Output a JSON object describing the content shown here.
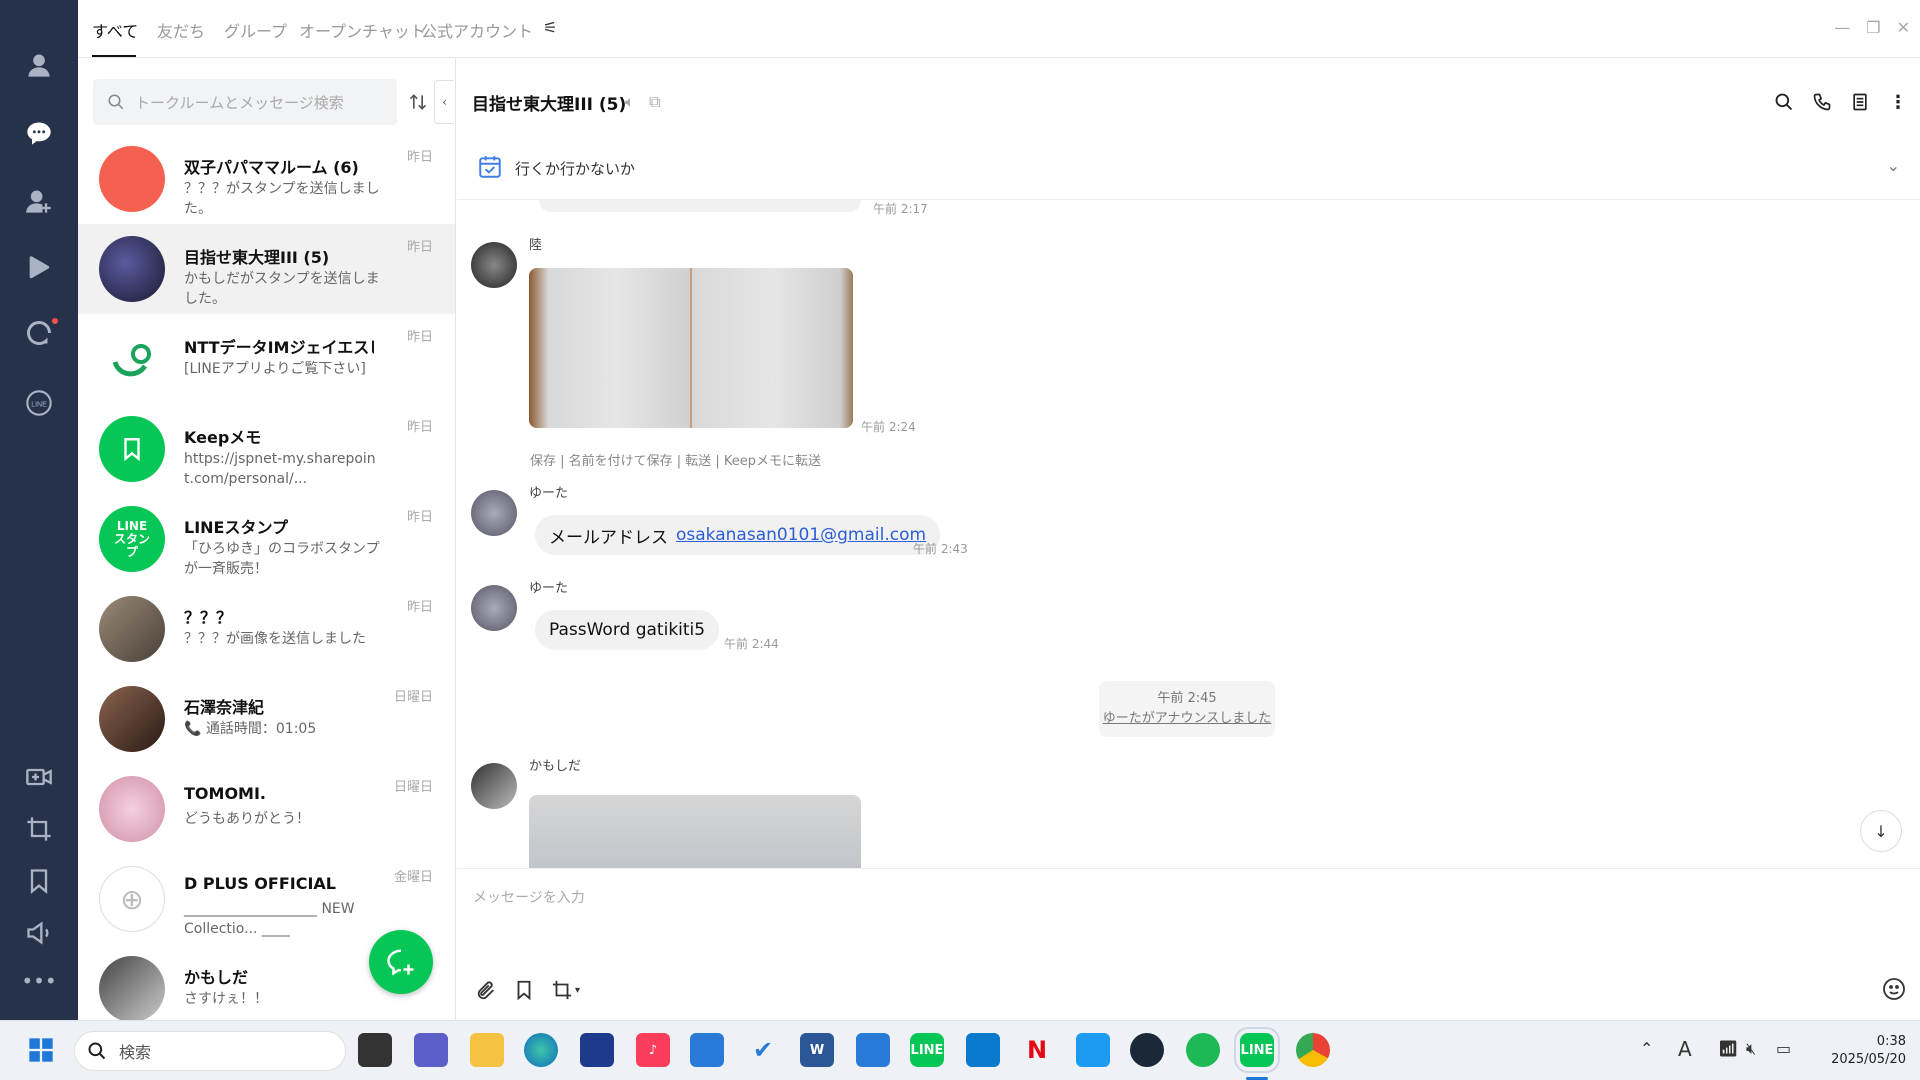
{
  "tabs": [
    "すべて",
    "友だち",
    "グループ",
    "オープンチャット",
    "公式アカウント"
  ],
  "search": {
    "placeholder": "トークルームとメッセージ検索"
  },
  "rooms": [
    {
      "name": "双子パパママルーム (6)",
      "msg": "？？？がスタンプを送信しました。",
      "time": "昨日",
      "color": "#f46150"
    },
    {
      "name": "目指せ東大理III (5)",
      "msg": "かもしだがスタンプを送信しました。",
      "time": "昨日",
      "color": "#3a3a6a"
    },
    {
      "name": "NTTデータIMジェイエスピー...",
      "msg": "[LINEアプリよりご覧下さい]",
      "time": "昨日",
      "color": "#ffffff"
    },
    {
      "name": "Keepメモ",
      "msg": "https://jspnet-my.sharepoint.com/personal/...",
      "time": "昨日",
      "color": "#06c755"
    },
    {
      "name": "LINEスタンプ",
      "msg": "「ひろゆき」のコラボスタンプが一斉販売！",
      "time": "昨日",
      "color": "#06c755"
    },
    {
      "name": "？？？",
      "msg": "？？？が画像を送信しました",
      "time": "昨日",
      "color": "#8a7a6a"
    },
    {
      "name": "石澤奈津紀",
      "msg": "📞 通話時間：01:05",
      "time": "日曜日",
      "color": "#6a5040"
    },
    {
      "name": "TOMOMI.",
      "msg": "どうもありがとう！",
      "time": "日曜日",
      "color": "#e8c0d0"
    },
    {
      "name": "D PLUS OFFICIAL",
      "msg": "___________________ NEW Collectio... ____",
      "time": "金曜日",
      "color": "#ffffff"
    },
    {
      "name": "かもしだ",
      "msg": "さすけぇ！！",
      "time": "",
      "color": "#555555"
    }
  ],
  "line_sticker_badge": "LINE スタンプ",
  "chat": {
    "title": "目指せ東大理III (5)",
    "announcement": "行くか行かないか",
    "prev_time": "午前 2:17",
    "messages": {
      "m1_sender": "陸",
      "m1_time": "午前 2:24",
      "m1_actions": "保存 | 名前を付けて保存 | 転送 | Keepメモに転送",
      "m2_sender": "ゆーた",
      "m2_text": "メールアドレス",
      "m2_link": "osakanasan0101@gmail.com",
      "m2_time": "午前 2:43",
      "m3_sender": "ゆーた",
      "m3_text": "PassWord gatikiti5",
      "m3_time": "午前 2:44",
      "sys_time": "午前 2:45",
      "sys_text": "ゆーたがアナウンスしました",
      "m4_sender": "かもしだ"
    },
    "compose_placeholder": "メッセージを入力"
  },
  "taskbar": {
    "search_label": "検索",
    "time": "0:38",
    "date": "2025/05/20",
    "ime": "A"
  },
  "colors": {
    "rail": "#25324a",
    "accent": "#06c755",
    "link": "#2c5ed8"
  }
}
